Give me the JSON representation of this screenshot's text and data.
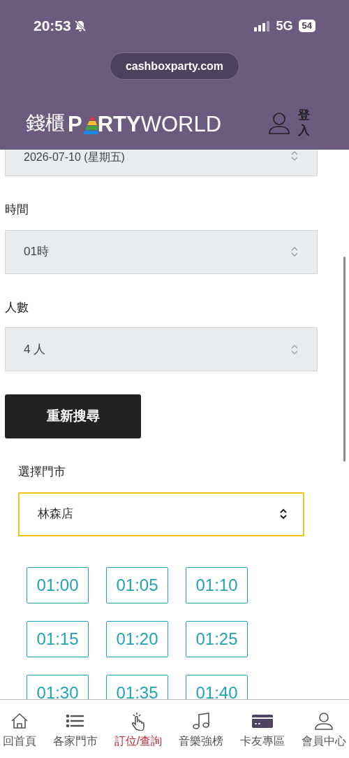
{
  "status_bar": {
    "time": "20:53",
    "network": "5G",
    "battery": "54"
  },
  "browser": {
    "url": "cashboxparty.com"
  },
  "header": {
    "logo": {
      "prefix": "錢櫃",
      "party_start": "P",
      "party_end": "RTY",
      "suffix": "WORLD"
    },
    "login": "登入"
  },
  "form": {
    "date": {
      "value": "2026-07-10 (星期五)"
    },
    "fields": [
      {
        "label": "時間",
        "value": "01時"
      },
      {
        "label": "人數",
        "value": "4 人"
      }
    ],
    "search_button": "重新搜尋"
  },
  "store": {
    "label": "選擇門市",
    "value": "林森店"
  },
  "time_slots": [
    {
      "label": "01:00"
    },
    {
      "label": "01:05"
    },
    {
      "label": "01:10"
    },
    {
      "label": "01:15"
    },
    {
      "label": "01:20"
    },
    {
      "label": "01:25"
    },
    {
      "label": "01:30"
    },
    {
      "label": "01:35"
    },
    {
      "label": "01:40"
    }
  ],
  "bottom_nav": [
    {
      "kind": "home",
      "label": "回首頁",
      "selected": false
    },
    {
      "kind": "list",
      "label": "各家門市",
      "selected": false
    },
    {
      "kind": "tap",
      "label": "訂位/查詢",
      "selected": true
    },
    {
      "kind": "music",
      "label": "音樂強榜",
      "selected": false
    },
    {
      "kind": "card",
      "label": "卡友專區",
      "selected": false
    },
    {
      "kind": "user",
      "label": "會員中心",
      "selected": false
    }
  ]
}
